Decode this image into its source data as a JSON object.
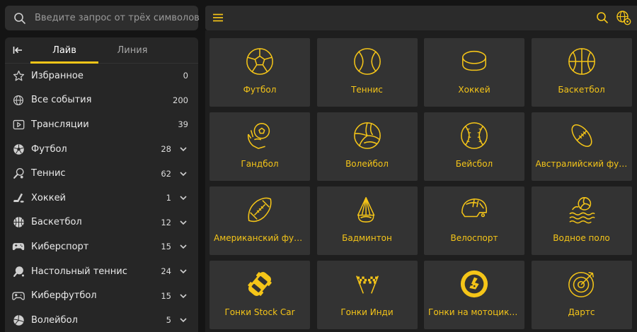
{
  "search": {
    "placeholder": "Введите запрос от трёх символов",
    "icon": "search-icon"
  },
  "tabs": [
    {
      "label": "Лайв",
      "active": true
    },
    {
      "label": "Линия",
      "active": false
    }
  ],
  "menu": [
    {
      "label": "Избранное",
      "count": "0",
      "icon": "star-icon",
      "expandable": false
    },
    {
      "label": "Все события",
      "count": "200",
      "icon": "globe-icon",
      "expandable": false
    },
    {
      "label": "Трансляции",
      "count": "39",
      "icon": "play-icon",
      "expandable": false
    },
    {
      "label": "Футбол",
      "count": "28",
      "icon": "soccer-ball-icon",
      "expandable": true
    },
    {
      "label": "Теннис",
      "count": "62",
      "icon": "tennis-racket-icon",
      "expandable": true
    },
    {
      "label": "Хоккей",
      "count": "1",
      "icon": "hockey-stick-icon",
      "expandable": true
    },
    {
      "label": "Баскетбол",
      "count": "12",
      "icon": "basketball-icon",
      "expandable": true
    },
    {
      "label": "Киберспорт",
      "count": "15",
      "icon": "gamepad-icon",
      "expandable": true
    },
    {
      "label": "Настольный теннис",
      "count": "24",
      "icon": "ping-pong-icon",
      "expandable": true
    },
    {
      "label": "Киберфутбол",
      "count": "15",
      "icon": "gamepad-ball-icon",
      "expandable": true
    },
    {
      "label": "Волейбол",
      "count": "5",
      "icon": "volleyball-icon",
      "expandable": true
    }
  ],
  "sports": [
    {
      "label": "Футбол",
      "icon": "soccer-ball-icon"
    },
    {
      "label": "Теннис",
      "icon": "tennis-ball-icon"
    },
    {
      "label": "Хоккей",
      "icon": "hockey-puck-icon"
    },
    {
      "label": "Баскетбол",
      "icon": "basketball-icon"
    },
    {
      "label": "Гандбол",
      "icon": "handball-icon"
    },
    {
      "label": "Волейбол",
      "icon": "volleyball-icon"
    },
    {
      "label": "Бейсбол",
      "icon": "baseball-icon"
    },
    {
      "label": "Австралийский футбол",
      "icon": "aussie-football-icon"
    },
    {
      "label": "Американский футбол",
      "icon": "american-football-icon"
    },
    {
      "label": "Бадминтон",
      "icon": "shuttlecock-icon"
    },
    {
      "label": "Велоспорт",
      "icon": "bike-helmet-icon"
    },
    {
      "label": "Водное поло",
      "icon": "water-polo-icon"
    },
    {
      "label": "Гонки Stock Car",
      "icon": "stock-car-icon"
    },
    {
      "label": "Гонки Инди",
      "icon": "checkered-flags-icon"
    },
    {
      "label": "Гонки на мотоциклах",
      "icon": "motorcycle-racing-icon"
    },
    {
      "label": "Дартс",
      "icon": "dart-target-icon"
    }
  ],
  "colors": {
    "accent": "#f5c518",
    "card": "#333333",
    "panel": "#262626",
    "background": "#141414"
  }
}
